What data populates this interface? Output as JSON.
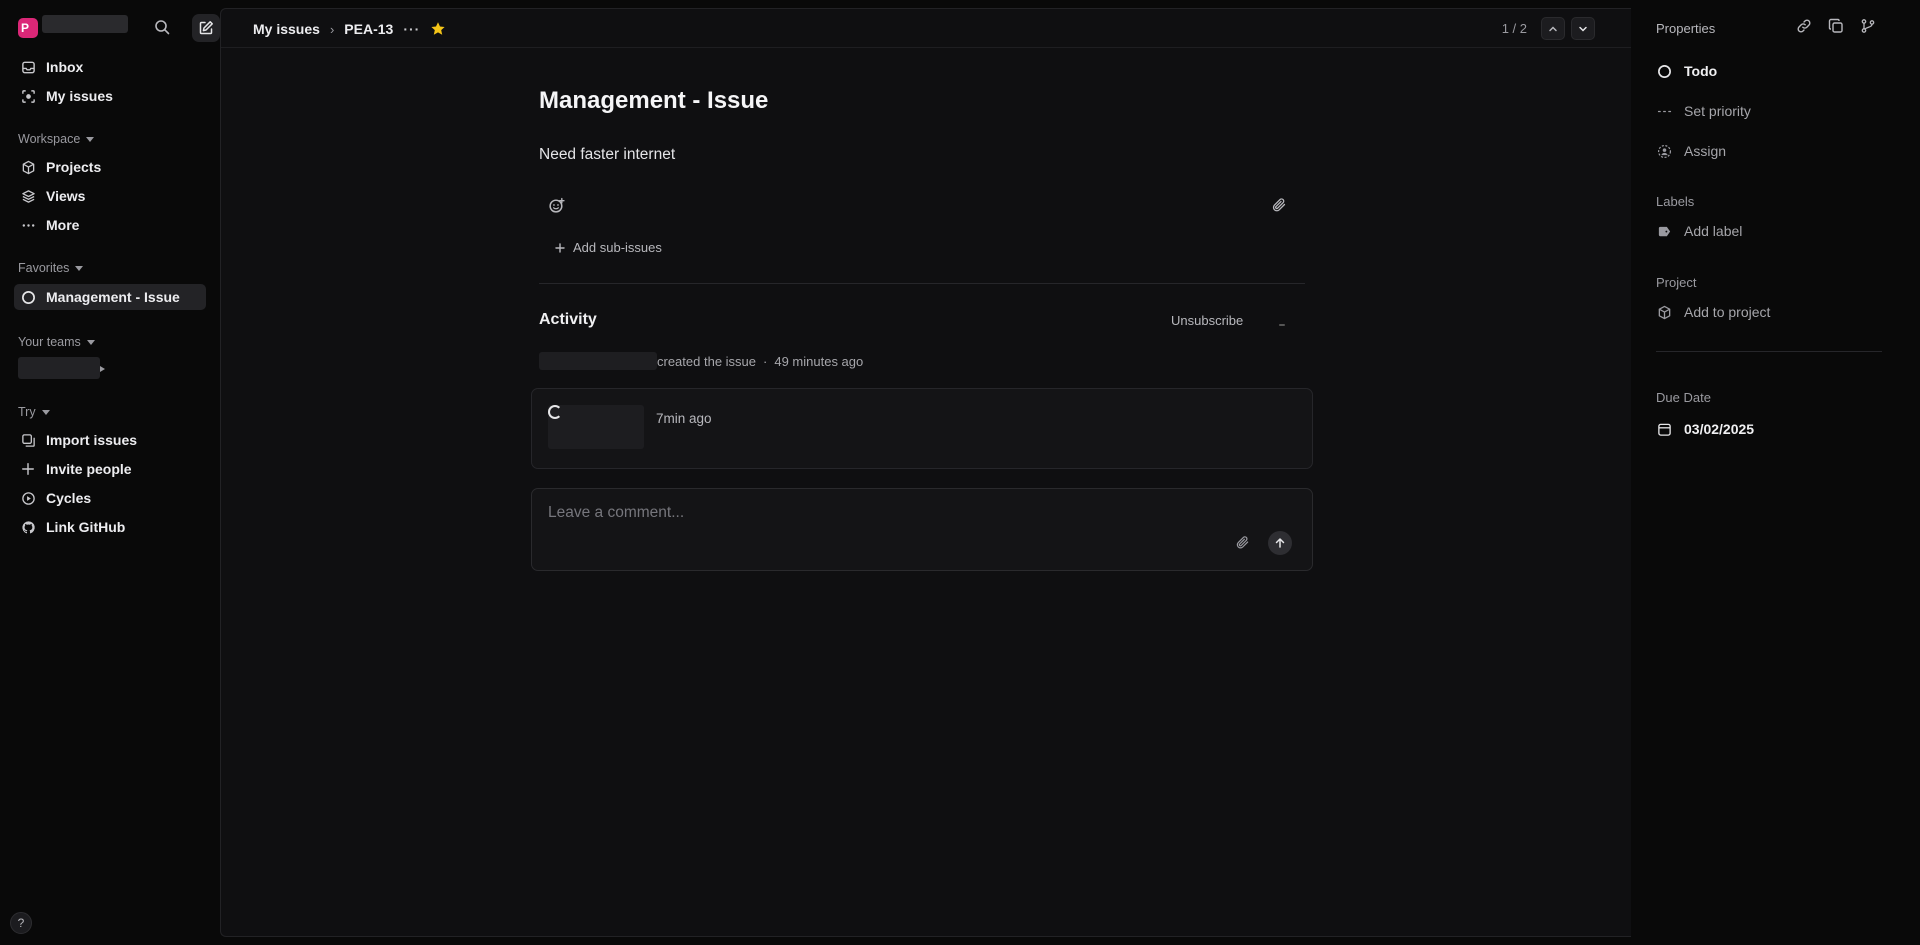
{
  "sidebar": {
    "workspace_initial": "P",
    "nav": [
      {
        "label": "Inbox",
        "icon": "inbox-icon"
      },
      {
        "label": "My issues",
        "icon": "my-issues-icon"
      }
    ],
    "workspace_section": {
      "label": "Workspace",
      "items": [
        {
          "label": "Projects",
          "icon": "cube-icon"
        },
        {
          "label": "Views",
          "icon": "layers-icon"
        },
        {
          "label": "More",
          "icon": "ellipsis-icon"
        }
      ]
    },
    "favorites_section": {
      "label": "Favorites",
      "items": [
        {
          "label": "Management - Issue",
          "icon": "todo-circle-icon"
        }
      ]
    },
    "teams_section": {
      "label": "Your teams"
    },
    "try_section": {
      "label": "Try",
      "items": [
        {
          "label": "Import issues",
          "icon": "import-icon"
        },
        {
          "label": "Invite people",
          "icon": "plus-icon"
        },
        {
          "label": "Cycles",
          "icon": "cycles-icon"
        },
        {
          "label": "Link GitHub",
          "icon": "github-icon"
        }
      ]
    },
    "help_label": "?"
  },
  "header": {
    "breadcrumb_parent": "My issues",
    "breadcrumb_sep": "›",
    "issue_id": "PEA-13",
    "more_label": "···",
    "pager": "1 / 2"
  },
  "issue": {
    "title": "Management - Issue",
    "description": "Need faster internet",
    "add_subissues": "Add sub-issues"
  },
  "activity": {
    "title": "Activity",
    "unsubscribe": "Unsubscribe",
    "created_text": "created the issue",
    "created_sep": "·",
    "created_time": "49 minutes ago",
    "comment_time": "7min ago",
    "compose_placeholder": "Leave a comment..."
  },
  "properties": {
    "heading": "Properties",
    "status": "Todo",
    "priority": "Set priority",
    "assign": "Assign",
    "labels_heading": "Labels",
    "add_label": "Add label",
    "project_heading": "Project",
    "add_to_project": "Add to project",
    "due_date_heading": "Due Date",
    "due_date": "03/02/2025"
  },
  "colors": {
    "brand": "#db2777",
    "favorite_star": "#f5c518",
    "background": "#090909",
    "panel": "#0f0f11"
  }
}
